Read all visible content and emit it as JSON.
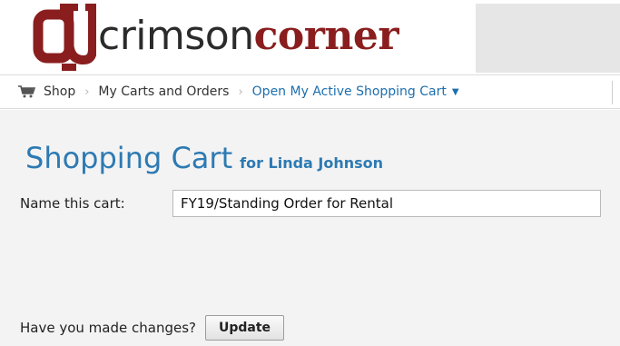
{
  "brand": {
    "name_light": "crimson",
    "name_bold": "corner",
    "logo_icon": "ou-interlock-logo",
    "primary_color": "#8a1e1e",
    "accent_color": "#2d7ab3"
  },
  "breadcrumb": {
    "items": [
      {
        "label": "Shop",
        "icon": "shopping-cart-icon"
      },
      {
        "label": "My Carts and Orders"
      },
      {
        "label": "Open My Active Shopping Cart",
        "dropdown": true
      }
    ],
    "separator": "›"
  },
  "page": {
    "title": "Shopping Cart",
    "subtitle": "for Linda Johnson"
  },
  "cart_name": {
    "label": "Name this cart:",
    "value": "FY19/Standing Order for Rental"
  },
  "update": {
    "prompt": "Have you made changes?",
    "button_label": "Update"
  }
}
